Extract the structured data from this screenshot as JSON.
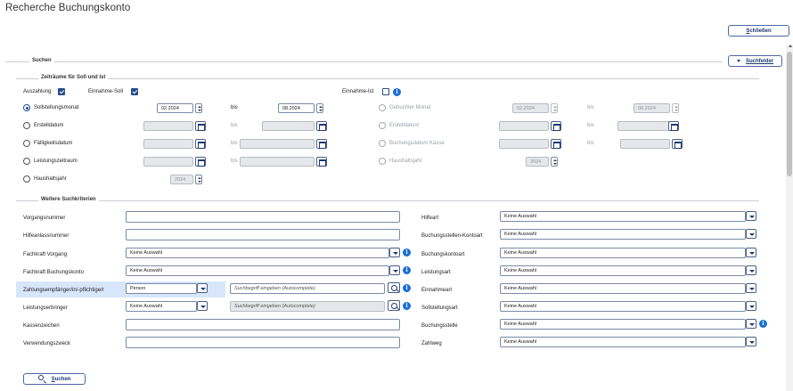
{
  "page_title": "Recherche Buchungskonto",
  "schliessen": {
    "accel": "S",
    "rest": "chließen"
  },
  "suchen_section": "Suchen",
  "suchfelder": {
    "accel": "Suchfelder",
    "prefix": ""
  },
  "zeitraeume": {
    "title": "Zeiträume für Soll und Ist",
    "auszahlung": "Auszahlung",
    "einnahme_soll": "Einnahme-Soll",
    "einnahme_ist": "Einnahme-Ist",
    "bis": "bis",
    "left": [
      {
        "label": "Sollstellungsmonat",
        "from": "02.2024",
        "to": "08.2024"
      },
      {
        "label": "Erstelldatum",
        "from": "",
        "to": ""
      },
      {
        "label": "Fälligkeitsdatum",
        "from": "",
        "to": ""
      },
      {
        "label": "Leistungszeitraum",
        "from": "",
        "to": ""
      },
      {
        "label": "Haushaltsjahr",
        "value": "2024"
      }
    ],
    "right": [
      {
        "label": "Gebuchter Monat",
        "from": "02.2024",
        "to": "08.2024"
      },
      {
        "label": "Erstelldatum",
        "from": "",
        "to": ""
      },
      {
        "label": "Buchungsdatum Kasse",
        "from": "",
        "to": ""
      },
      {
        "label": "Haushaltsjahr",
        "value": "2024"
      }
    ]
  },
  "weitere": {
    "title": "Weitere Suchkriterien",
    "left": [
      {
        "label": "Vorgangsnummer",
        "value": ""
      },
      {
        "label": "Hilfeanlassnummer",
        "value": ""
      },
      {
        "label": "Fachkraft Vorgang",
        "value": "Keine Auswahl"
      },
      {
        "label": "Fachkraft Buchungskonto",
        "value": "Keine Auswahl"
      },
      {
        "label": "Zahlungsempfänger/in/-pflichtige/r",
        "value": "Person",
        "search_placeholder": "Suchbegriff eingeben (Autocomplete)"
      },
      {
        "label": "Leistungserbringer",
        "value": "Keine Auswahl",
        "search_placeholder": "Suchbegriff eingeben (Autocomplete)"
      },
      {
        "label": "Kassenzeichen",
        "value": ""
      },
      {
        "label": "Verwendungszweck",
        "value": ""
      }
    ],
    "right": [
      {
        "label": "Hilfeart",
        "value": "Keine Auswahl"
      },
      {
        "label": "Buchungsstellen-Kontoart",
        "value": "Keine Auswahl"
      },
      {
        "label": "Buchungskontoart",
        "value": "Keine Auswahl"
      },
      {
        "label": "Leistungsart",
        "value": "Keine Auswahl"
      },
      {
        "label": "Einnahmeart",
        "value": "Keine Auswahl"
      },
      {
        "label": "Sollstellungsart",
        "value": "Keine Auswahl"
      },
      {
        "label": "Buchungsstelle",
        "value": "Keine Auswahl"
      },
      {
        "label": "Zahlweg",
        "value": "Keine Auswahl"
      }
    ]
  },
  "suchen_button": {
    "accel": "S",
    "rest": "uchen"
  },
  "info_glyph": "i"
}
